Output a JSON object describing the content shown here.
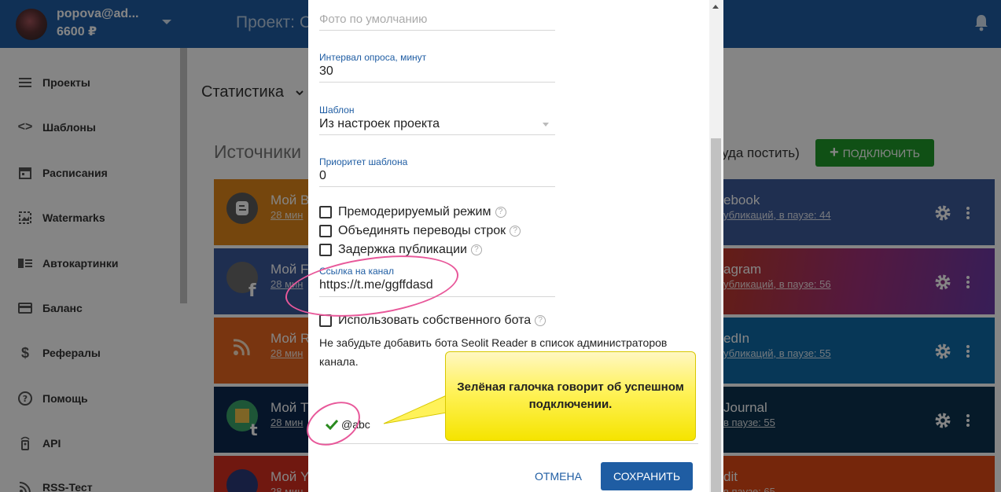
{
  "header": {
    "user_email": "popova@ad...",
    "user_balance": "6600 ₽",
    "project_title": "Проект: С"
  },
  "sidebar": {
    "items": [
      {
        "label": "Проекты",
        "icon": "list-icon"
      },
      {
        "label": "Шаблоны",
        "icon": "code-icon"
      },
      {
        "label": "Расписания",
        "icon": "calendar-icon"
      },
      {
        "label": "Watermarks",
        "icon": "image-icon"
      },
      {
        "label": "Автокартинки",
        "icon": "picture-list-icon"
      },
      {
        "label": "Баланс",
        "icon": "credit-card-icon"
      },
      {
        "label": "Рефералы",
        "icon": "dollar-icon"
      },
      {
        "label": "Помощь",
        "icon": "help-icon"
      },
      {
        "label": "API",
        "icon": "remote-icon"
      },
      {
        "label": "RSS-Тест",
        "icon": "rss-icon"
      }
    ]
  },
  "main": {
    "stats_title": "Статистика",
    "sources_title": "Источники",
    "where_to_post": "уда постить)",
    "connect_button": "ПОДКЛЮЧИТЬ",
    "sources": [
      {
        "name": "Мой B",
        "sub": "28 мин",
        "color": "#e0871a"
      },
      {
        "name": "Мой F",
        "sub": "28 мин",
        "color": "#3a5899"
      },
      {
        "name": "Мой R",
        "sub": "28 мин",
        "color": "#e8661f"
      },
      {
        "name": "Мой T",
        "sub": "28 мин",
        "color": "#0d2a4f"
      },
      {
        "name": "Мой Y",
        "sub": "28 мин",
        "color": "#d62e20"
      }
    ],
    "targets": [
      {
        "name": "ebook",
        "sub": "убликаций, в паузе: 44",
        "color": "#3c5a99"
      },
      {
        "name": "agram",
        "sub": "убликаций, в паузе: 56",
        "color": "#a1307a"
      },
      {
        "name": "edIn",
        "sub": "убликаций, в паузе: 55",
        "color": "#0f6aa8"
      },
      {
        "name": "Journal",
        "sub": "в паузе: 55",
        "color": "#0c3350"
      },
      {
        "name": "dit",
        "sub": "в паузе: 65",
        "color": "#e04a16"
      }
    ]
  },
  "modal": {
    "default_photo_placeholder": "Фото по умолчанию",
    "poll_interval_label": "Интервал опроса, минут",
    "poll_interval_value": "30",
    "template_label": "Шаблон",
    "template_value": "Из настроек проекта",
    "template_priority_label": "Приоритет шаблона",
    "template_priority_value": "0",
    "checkboxes": [
      {
        "label": "Премодерируемый режим",
        "checked": false
      },
      {
        "label": "Объединять переводы строк",
        "checked": false
      },
      {
        "label": "Задержка публикации",
        "checked": false
      }
    ],
    "channel_link_label": "Ссылка на канал",
    "channel_link_value": "https://t.me/ggffdasd",
    "own_bot_label": "Использовать собственного бота",
    "note": "Не забудьте добавить бота Seolit Reader в список администраторов канала.",
    "bot_name": "@abc",
    "cancel": "ОТМЕНА",
    "save": "СОХРАНИТЬ"
  },
  "annotation": {
    "callout_text": "Зелёная галочка говорит об успешном подключении."
  },
  "colors": {
    "primary": "#1f5da3",
    "success": "#1f9a2a",
    "annotation": "#e8589a",
    "callout": "#fff259"
  }
}
